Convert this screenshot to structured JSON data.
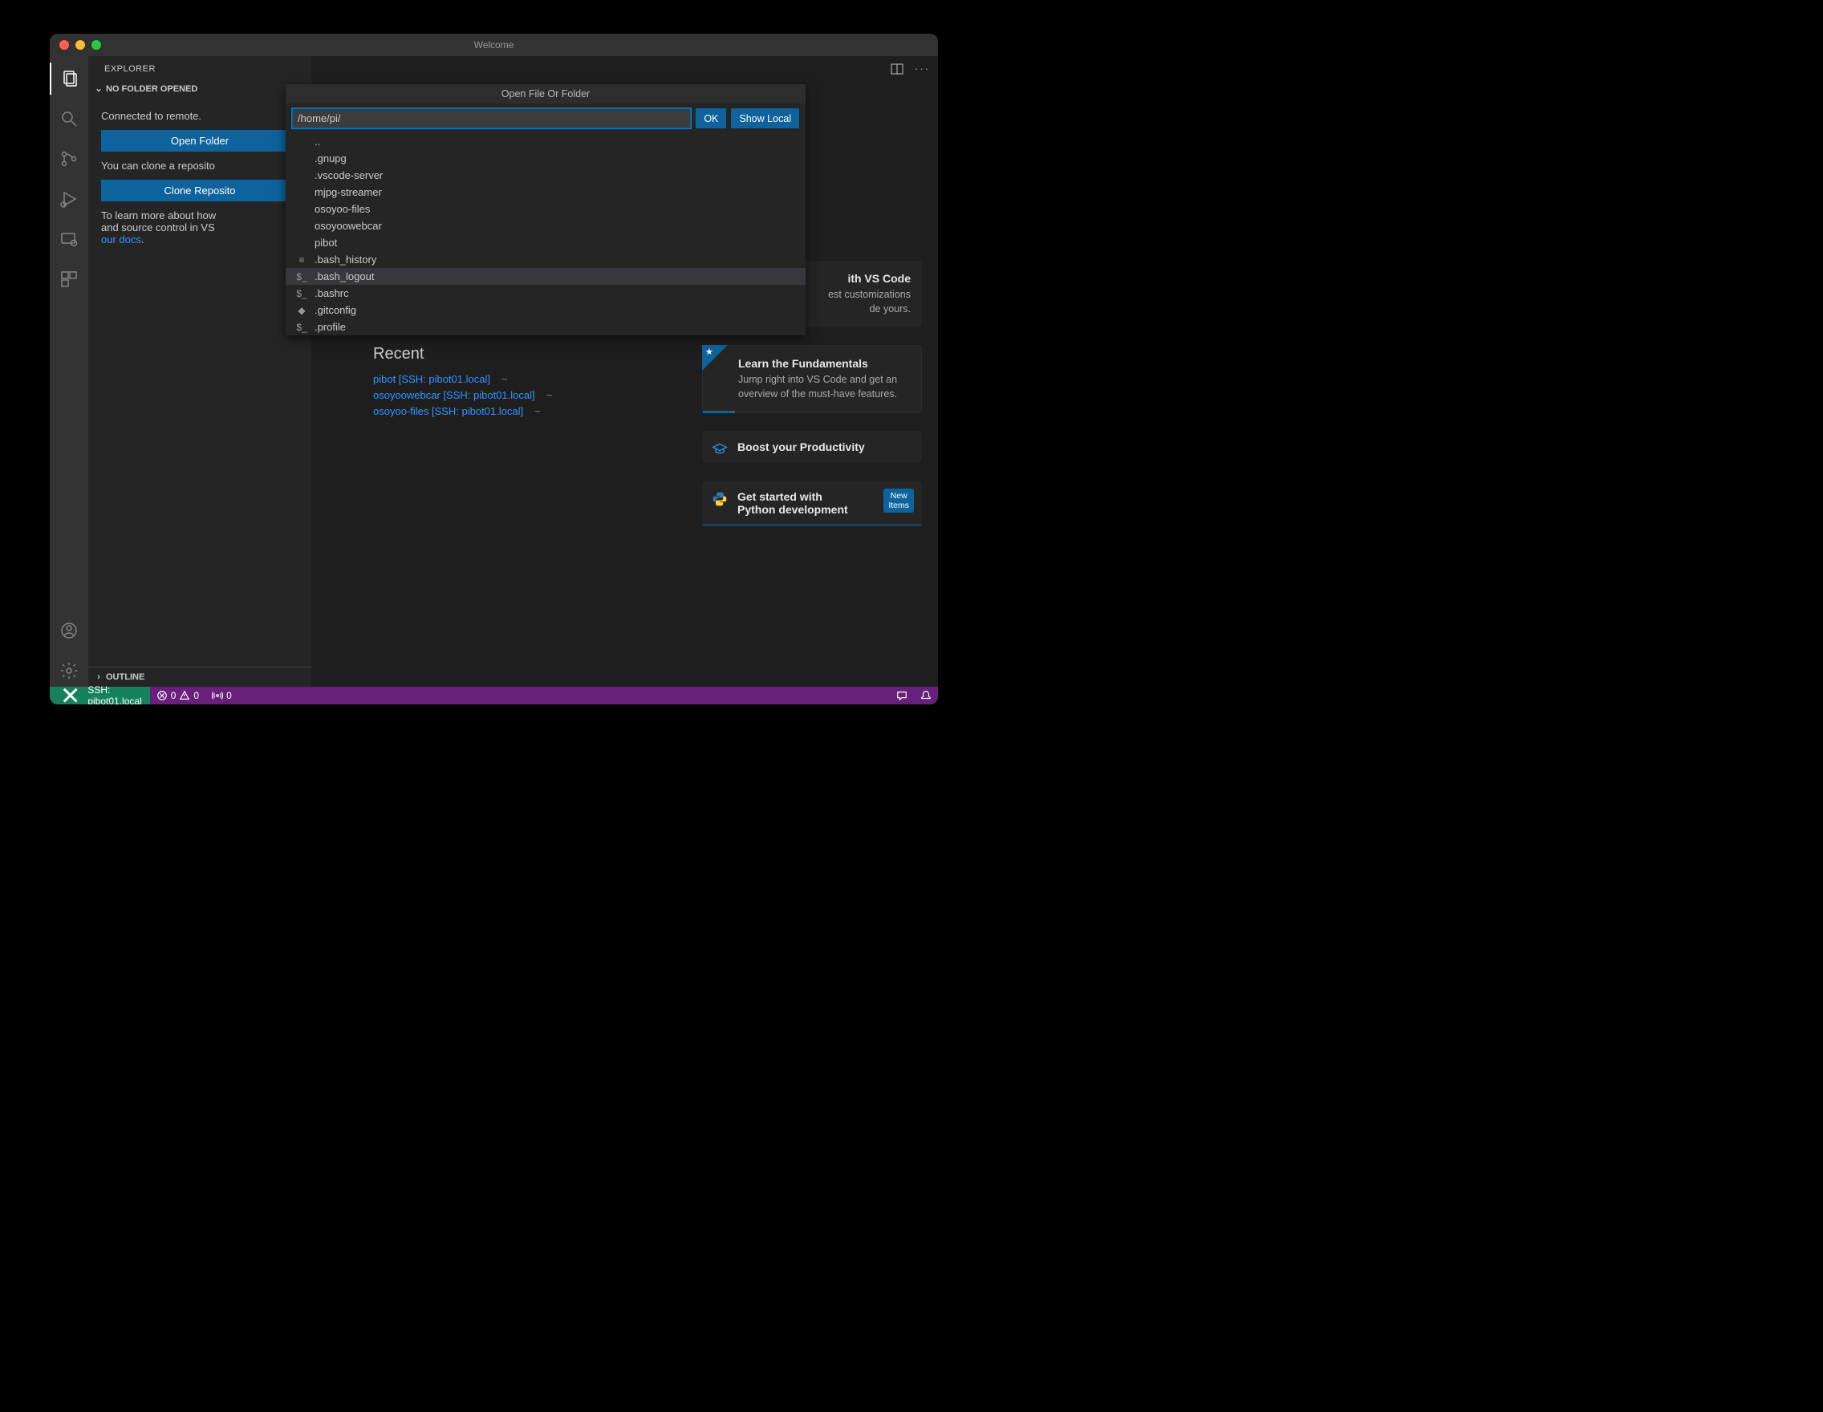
{
  "titlebar": {
    "title": "Welcome"
  },
  "sidebar": {
    "title": "EXPLORER",
    "section_label": "NO FOLDER OPENED",
    "connected_text": "Connected to remote.",
    "open_folder_btn": "Open Folder",
    "clone_text_partial": "You can clone a reposito",
    "clone_btn": "Clone Reposito",
    "learn_text_1": "To learn more about how",
    "learn_text_2": "and source control in VS",
    "docs_link": "our docs",
    "outline_label": "OUTLINE"
  },
  "quick_input": {
    "title": "Open File Or Folder",
    "path_value": "/home/pi/",
    "ok_btn": "OK",
    "show_local_btn": "Show Local",
    "items": [
      {
        "label": "..",
        "icon": ""
      },
      {
        "label": ".gnupg",
        "icon": ""
      },
      {
        "label": ".vscode-server",
        "icon": ""
      },
      {
        "label": "mjpg-streamer",
        "icon": ""
      },
      {
        "label": "osoyoo-files",
        "icon": ""
      },
      {
        "label": "osoyoowebcar",
        "icon": ""
      },
      {
        "label": "pibot",
        "icon": ""
      },
      {
        "label": ".bash_history",
        "icon": "≡"
      },
      {
        "label": ".bash_logout",
        "icon": "$_",
        "hover": true
      },
      {
        "label": ".bashrc",
        "icon": "$_"
      },
      {
        "label": ".gitconfig",
        "icon": "◆"
      },
      {
        "label": ".profile",
        "icon": "$_"
      }
    ]
  },
  "welcome": {
    "vscode_card_title_frag": "ith VS Code",
    "vscode_card_desc_1": "est customizations",
    "vscode_card_desc_2": "de yours.",
    "recent_heading": "Recent",
    "recent": [
      {
        "name": "pibot [SSH: pibot01.local]",
        "path": "~"
      },
      {
        "name": "osoyoowebcar [SSH: pibot01.local]",
        "path": "~"
      },
      {
        "name": "osoyoo-files [SSH: pibot01.local]",
        "path": "~"
      }
    ],
    "card_fundamentals_title": "Learn the Fundamentals",
    "card_fundamentals_desc": "Jump right into VS Code and get an overview of the must-have features.",
    "card_productivity": "Boost your Productivity",
    "card_python_title": "Get started with Python development",
    "badge_new_l1": "New",
    "badge_new_l2": "Items"
  },
  "statusbar": {
    "remote_label": "SSH: pibot01.local",
    "errors": "0",
    "warnings": "0",
    "ports": "0"
  }
}
